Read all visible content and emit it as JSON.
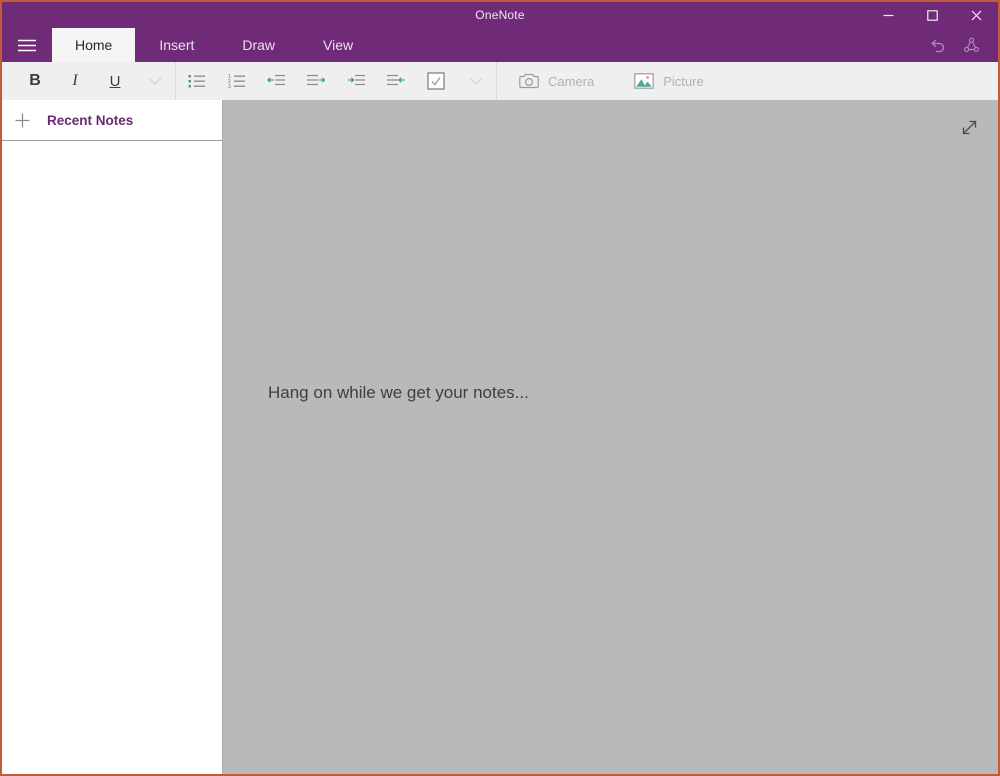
{
  "window": {
    "title": "OneNote"
  },
  "ribbon": {
    "tabs": [
      {
        "label": "Home",
        "active": true
      },
      {
        "label": "Insert",
        "active": false
      },
      {
        "label": "Draw",
        "active": false
      },
      {
        "label": "View",
        "active": false
      }
    ]
  },
  "toolbar": {
    "bold_label": "B",
    "italic_label": "I",
    "underline_label": "U",
    "camera_label": "Camera",
    "picture_label": "Picture"
  },
  "sidebar": {
    "header": "Recent Notes"
  },
  "canvas": {
    "message": "Hang on while we get your notes..."
  },
  "icons": {
    "hamburger": "menu (three lines)",
    "minimize": "–",
    "maximize": "□",
    "close": "✕",
    "undo": "curved back arrow",
    "sync": "three-dot sync triangle",
    "chevron_down": "⌄",
    "bullet_list": "bulleted list",
    "numbered_list": "numbered list",
    "outdent": "decrease indent (teal left arrow)",
    "ltr_paragraph": "lines with right arrow",
    "indent": "increase indent (teal right arrow)",
    "rtl_paragraph": "lines with left arrow",
    "todo_checkbox": "checked box tag",
    "camera": "camera outline",
    "picture": "photo with teal mountains and pink sun",
    "add": "+",
    "expand": "diagonal resize arrow"
  },
  "colors": {
    "accent_purple": "#702b78",
    "window_border_orange": "#c05b3c",
    "toolbar_bg": "#f0eff0",
    "active_tab_bg": "#f6f5f6",
    "canvas_gray": "#b9b9b9",
    "teal_accent": "#3a9e8f",
    "sidebar_header_purple": "#682a70",
    "disabled_text": "#b3b1b3"
  }
}
